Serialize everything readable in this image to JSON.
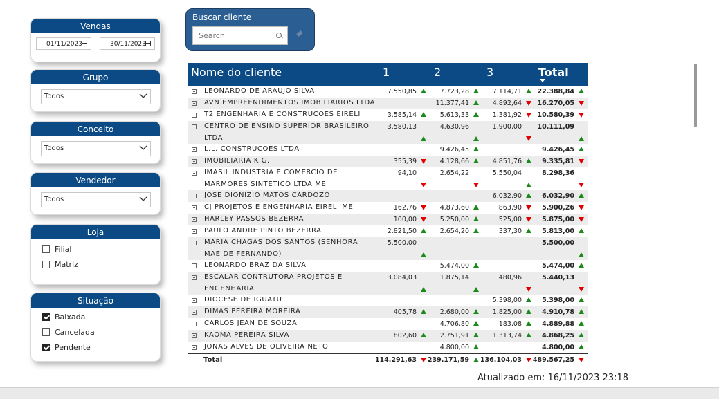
{
  "slicers": {
    "vendas": {
      "title": "Vendas",
      "date_from": "01/11/2023",
      "date_to": "30/11/2023"
    },
    "grupo": {
      "title": "Grupo",
      "value": "Todos"
    },
    "conceito": {
      "title": "Conceito",
      "value": "Todos"
    },
    "vendedor": {
      "title": "Vendedor",
      "value": "Todos"
    },
    "loja": {
      "title": "Loja",
      "options": [
        {
          "label": "Filial",
          "checked": false
        },
        {
          "label": "Matriz",
          "checked": false
        }
      ]
    },
    "situacao": {
      "title": "Situação",
      "options": [
        {
          "label": "Baixada",
          "checked": true
        },
        {
          "label": "Cancelada",
          "checked": false
        },
        {
          "label": "Pendente",
          "checked": true
        }
      ]
    }
  },
  "search": {
    "title": "Buscar cliente",
    "placeholder": "Search"
  },
  "table": {
    "headers": {
      "name": "Nome do cliente",
      "c1": "1",
      "c2": "2",
      "c3": "3",
      "total": "Total"
    },
    "rows": [
      {
        "name": "LEONARDO DE ARAUJO SILVA",
        "v1": "7.550,85",
        "t1": "up",
        "v2": "7.723,28",
        "t2": "up",
        "v3": "7.114,71",
        "t3": "up",
        "total": "22.388,84",
        "tt": "up"
      },
      {
        "name": "AVN EMPREENDIMENTOS IMOBILIARIOS LTDA",
        "v1": "",
        "t1": "",
        "v2": "11.377,41",
        "t2": "up",
        "v3": "4.892,64",
        "t3": "down",
        "total": "16.270,05",
        "tt": "down"
      },
      {
        "name": "T2 ENGENHARIA E CONSTRUCOES EIRELI",
        "v1": "3.585,14",
        "t1": "up",
        "v2": "5.613,33",
        "t2": "up",
        "v3": "1.381,92",
        "t3": "down",
        "total": "10.580,39",
        "tt": "down"
      },
      {
        "name": "CENTRO DE ENSINO SUPERIOR BRASILEIRO LTDA",
        "v1": "3.580,13",
        "t1": "up",
        "v2": "4.630,96",
        "t2": "up",
        "v3": "1.900,00",
        "t3": "down",
        "total": "10.111,09",
        "tt": "up"
      },
      {
        "name": "L.L. CONSTRUCOES LTDA",
        "v1": "",
        "t1": "",
        "v2": "9.426,45",
        "t2": "up",
        "v3": "",
        "t3": "",
        "total": "9.426,45",
        "tt": "up"
      },
      {
        "name": "IMOBILIARIA K.G.",
        "v1": "355,39",
        "t1": "down",
        "v2": "4.128,66",
        "t2": "up",
        "v3": "4.851,76",
        "t3": "up",
        "total": "9.335,81",
        "tt": "down"
      },
      {
        "name": "IMASIL INDUSTRIA E COMERCIO DE MARMORES SINTETICO LTDA ME",
        "v1": "94,10",
        "t1": "down",
        "v2": "2.654,22",
        "t2": "down",
        "v3": "5.550,04",
        "t3": "up",
        "total": "8.298,36",
        "tt": "down"
      },
      {
        "name": "JOSE DIONIZIO MATOS CARDOZO",
        "v1": "",
        "t1": "",
        "v2": "",
        "t2": "",
        "v3": "6.032,90",
        "t3": "up",
        "total": "6.032,90",
        "tt": "up"
      },
      {
        "name": "CJ PROJETOS E ENGENHARIA EIRELI ME",
        "v1": "162,76",
        "t1": "down",
        "v2": "4.873,60",
        "t2": "up",
        "v3": "863,90",
        "t3": "down",
        "total": "5.900,26",
        "tt": "down"
      },
      {
        "name": "HARLEY PASSOS BEZERRA",
        "v1": "100,00",
        "t1": "down",
        "v2": "5.250,00",
        "t2": "up",
        "v3": "525,00",
        "t3": "down",
        "total": "5.875,00",
        "tt": "down"
      },
      {
        "name": "PAULO ANDRE PINTO BEZERRA",
        "v1": "2.821,50",
        "t1": "up",
        "v2": "2.654,20",
        "t2": "up",
        "v3": "337,30",
        "t3": "up",
        "total": "5.813,00",
        "tt": "up"
      },
      {
        "name": "MARIA CHAGAS DOS SANTOS (SENHORA MAE DE FERNANDO)",
        "v1": "5.500,00",
        "t1": "up",
        "v2": "",
        "t2": "",
        "v3": "",
        "t3": "",
        "total": "5.500,00",
        "tt": "up"
      },
      {
        "name": "LEONARDO BRAZ DA SILVA",
        "v1": "",
        "t1": "",
        "v2": "5.474,00",
        "t2": "up",
        "v3": "",
        "t3": "",
        "total": "5.474,00",
        "tt": "up"
      },
      {
        "name": "ESCALAR CONTRUTORA PROJETOS E ENGENHARIA",
        "v1": "3.084,03",
        "t1": "up",
        "v2": "1.875,14",
        "t2": "up",
        "v3": "480,96",
        "t3": "down",
        "total": "5.440,13",
        "tt": "down"
      },
      {
        "name": "DIOCESE DE IGUATU",
        "v1": "",
        "t1": "",
        "v2": "",
        "t2": "",
        "v3": "5.398,00",
        "t3": "up",
        "total": "5.398,00",
        "tt": "up"
      },
      {
        "name": "DIMAS PEREIRA MOREIRA",
        "v1": "405,78",
        "t1": "up",
        "v2": "2.680,00",
        "t2": "up",
        "v3": "1.825,00",
        "t3": "up",
        "total": "4.910,78",
        "tt": "up"
      },
      {
        "name": "CARLOS JEAN DE SOUZA",
        "v1": "",
        "t1": "",
        "v2": "4.706,80",
        "t2": "up",
        "v3": "183,08",
        "t3": "up",
        "total": "4.889,88",
        "tt": "up"
      },
      {
        "name": "KAOMA PEREIRA SILVA",
        "v1": "802,60",
        "t1": "up",
        "v2": "2.751,91",
        "t2": "up",
        "v3": "1.313,74",
        "t3": "up",
        "total": "4.868,25",
        "tt": "up"
      },
      {
        "name": "JONAS ALVES DE OLIVEIRA NETO",
        "v1": "",
        "t1": "",
        "v2": "4.800,00",
        "t2": "up",
        "v3": "",
        "t3": "",
        "total": "4.800,00",
        "tt": "up"
      }
    ],
    "totals": {
      "label": "Total",
      "v1": "114.291,63",
      "t1": "down",
      "v2": "239.171,59",
      "t2": "up",
      "v3": "136.104,03",
      "t3": "down",
      "total": "489.567,25",
      "tt": "down"
    }
  },
  "updated": "Atualizado em: 16/11/2023 23:18",
  "colors": {
    "header": "#0b4a85",
    "up": "#1a8a1a",
    "down": "#e00000",
    "search_bg": "#2b5f93"
  }
}
